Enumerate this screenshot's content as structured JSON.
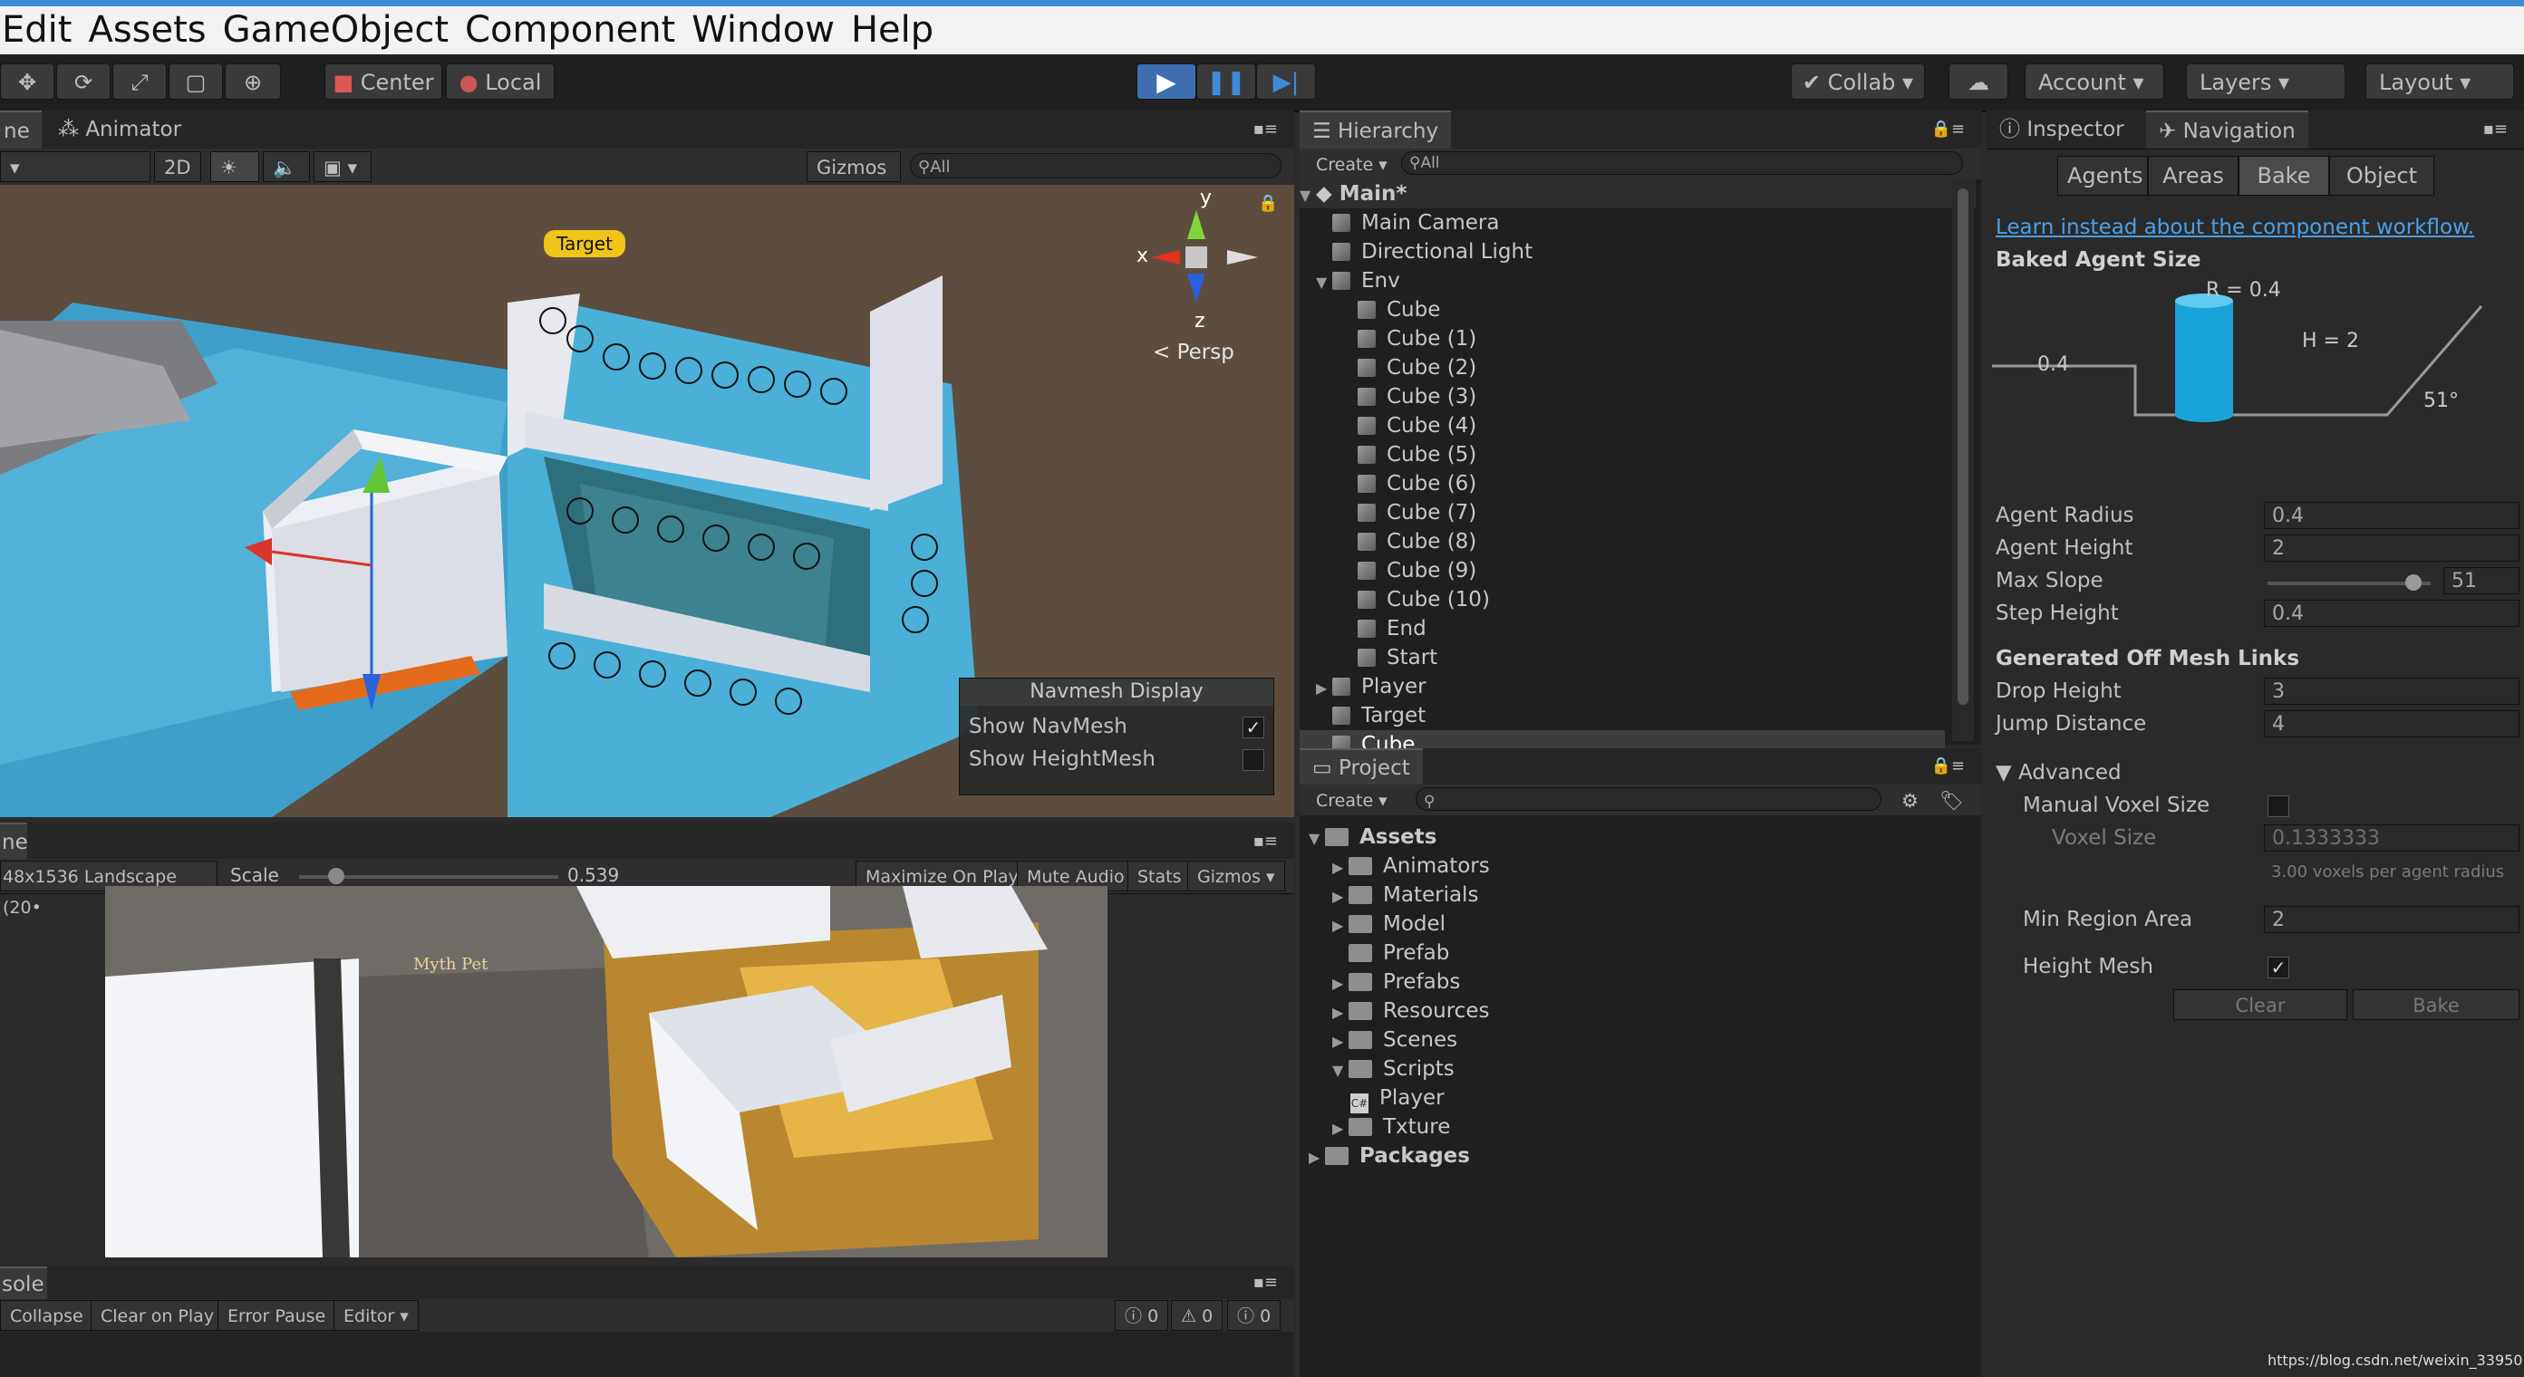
{
  "menu": [
    "Edit",
    "Assets",
    "GameObject",
    "Component",
    "Window",
    "Help"
  ],
  "toolbar": {
    "center_label": "Center",
    "local_label": "Local",
    "collab_label": "Collab",
    "account_label": "Account",
    "layers_label": "Layers",
    "layout_label": "Layout"
  },
  "scene": {
    "tab_partial": "ne",
    "animator_tab": "Animator",
    "mode_2d": "2D",
    "gizmos": "Gizmos",
    "search_placeholder": "All",
    "target_label": "Target",
    "axis_y": "y",
    "axis_x": "x",
    "axis_z": "z",
    "persp_label": "< Persp",
    "navmesh_display": {
      "title": "Navmesh Display",
      "show_navmesh": "Show NavMesh",
      "show_heightmesh": "Show HeightMesh"
    }
  },
  "game": {
    "tab_partial": "ne",
    "resolution": "48x1536 Landscape (20•",
    "scale_label": "Scale",
    "scale_value": "0.539",
    "maximize_on_play": "Maximize On Play",
    "mute_audio": "Mute Audio",
    "stats": "Stats",
    "gizmos": "Gizmos",
    "myth_pet_text": "Myth Pet"
  },
  "console": {
    "tab_partial": "sole",
    "collapse": "Collapse",
    "clear_on_play": "Clear on Play",
    "error_pause": "Error Pause",
    "editor": "Editor",
    "counts": [
      "0",
      "0",
      "0"
    ]
  },
  "hierarchy": {
    "tab": "Hierarchy",
    "create": "Create",
    "search_placeholder": "All",
    "scene_name": "Main*",
    "items": [
      {
        "label": "Main Camera",
        "indent": 1,
        "arrow": ""
      },
      {
        "label": "Directional Light",
        "indent": 1,
        "arrow": ""
      },
      {
        "label": "Env",
        "indent": 1,
        "arrow": "▼"
      },
      {
        "label": "Cube",
        "indent": 2,
        "arrow": ""
      },
      {
        "label": "Cube (1)",
        "indent": 2,
        "arrow": ""
      },
      {
        "label": "Cube (2)",
        "indent": 2,
        "arrow": ""
      },
      {
        "label": "Cube (3)",
        "indent": 2,
        "arrow": ""
      },
      {
        "label": "Cube (4)",
        "indent": 2,
        "arrow": ""
      },
      {
        "label": "Cube (5)",
        "indent": 2,
        "arrow": ""
      },
      {
        "label": "Cube (6)",
        "indent": 2,
        "arrow": ""
      },
      {
        "label": "Cube (7)",
        "indent": 2,
        "arrow": ""
      },
      {
        "label": "Cube (8)",
        "indent": 2,
        "arrow": ""
      },
      {
        "label": "Cube (9)",
        "indent": 2,
        "arrow": ""
      },
      {
        "label": "Cube (10)",
        "indent": 2,
        "arrow": ""
      },
      {
        "label": "End",
        "indent": 2,
        "arrow": ""
      },
      {
        "label": "Start",
        "indent": 2,
        "arrow": ""
      },
      {
        "label": "Player",
        "indent": 1,
        "arrow": "▶"
      },
      {
        "label": "Target",
        "indent": 1,
        "arrow": ""
      },
      {
        "label": "Cube",
        "indent": 1,
        "arrow": "",
        "selected": true
      }
    ]
  },
  "project": {
    "tab": "Project",
    "create": "Create",
    "assets_root": "Assets",
    "folders": [
      {
        "label": "Animators",
        "arrow": "▶"
      },
      {
        "label": "Materials",
        "arrow": "▶"
      },
      {
        "label": "Model",
        "arrow": "▶"
      },
      {
        "label": "Prefab",
        "arrow": ""
      },
      {
        "label": "Prefabs",
        "arrow": "▶"
      },
      {
        "label": "Resources",
        "arrow": "▶"
      },
      {
        "label": "Scenes",
        "arrow": "▶"
      },
      {
        "label": "Scripts",
        "arrow": "▼"
      }
    ],
    "script_file": "Player",
    "txture": "Txture",
    "packages": "Packages"
  },
  "inspector": {
    "inspector_tab": "Inspector",
    "navigation_tab": "Navigation",
    "subtabs": [
      "Agents",
      "Areas",
      "Bake",
      "Object"
    ],
    "active_subtab": "Bake",
    "learn_link": "Learn instead about the component workflow.",
    "baked_agent_size": "Baked Agent Size",
    "diagram": {
      "r_label": "R = 0.4",
      "h_label": "H = 2",
      "step_label": "0.4",
      "slope_label": "51°"
    },
    "agent_radius_label": "Agent Radius",
    "agent_radius": "0.4",
    "agent_height_label": "Agent Height",
    "agent_height": "2",
    "max_slope_label": "Max Slope",
    "max_slope": "51",
    "step_height_label": "Step Height",
    "step_height": "0.4",
    "offmesh_header": "Generated Off Mesh Links",
    "drop_height_label": "Drop Height",
    "drop_height": "3",
    "jump_distance_label": "Jump Distance",
    "jump_distance": "4",
    "advanced_label": "Advanced",
    "manual_voxel_label": "Manual Voxel Size",
    "voxel_size_label": "Voxel Size",
    "voxel_size": "0.1333333",
    "voxel_hint": "3.00 voxels per agent radius",
    "min_region_label": "Min Region Area",
    "min_region": "2",
    "height_mesh_label": "Height Mesh",
    "clear_button": "Clear",
    "bake_button": "Bake"
  },
  "watermark": "https://blog.csdn.net/weixin_33950757"
}
